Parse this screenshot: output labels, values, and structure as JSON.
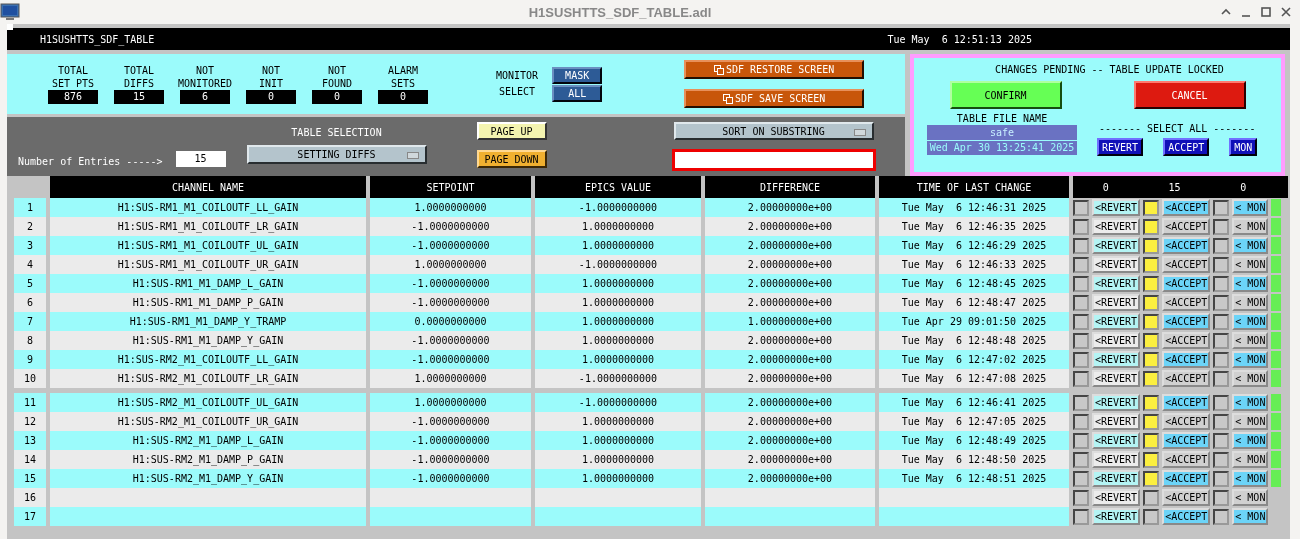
{
  "window": {
    "title": "H1SUSHTTS_SDF_TABLE.adl"
  },
  "header_bar": {
    "name": "H1SUSHTTS_SDF_TABLE",
    "datetime": "Tue May  6 12:51:13 2025"
  },
  "stats": [
    {
      "label": "TOTAL\nSET PTS",
      "value": "876"
    },
    {
      "label": "TOTAL\nDIFFS",
      "value": "15"
    },
    {
      "label": "NOT\nMONITORED",
      "value": "6"
    },
    {
      "label": "NOT\nINIT",
      "value": "0"
    },
    {
      "label": "NOT\nFOUND",
      "value": "0"
    },
    {
      "label": "ALARM\nSETS",
      "value": "0"
    }
  ],
  "monitor_select": {
    "label": "MONITOR\nSELECT",
    "buttons": [
      "MASK",
      "ALL"
    ]
  },
  "screen_buttons": [
    "SDF RESTORE SCREEN",
    "SDF SAVE SCREEN"
  ],
  "controls": {
    "entries_label": "Number of Entries ----->",
    "entries_value": "15",
    "table_selection_label": "TABLE SELECTION",
    "table_selection": "SETTING DIFFS",
    "page_up": "PAGE UP",
    "page_down": "PAGE DOWN",
    "sort_menu": "SORT ON SUBSTRING"
  },
  "pending": {
    "message": "CHANGES PENDING -- TABLE UPDATE LOCKED",
    "confirm": "CONFIRM",
    "cancel": "CANCEL",
    "table_file_label": "TABLE FILE NAME",
    "table_file": "safe",
    "table_file_date": "Wed Apr 30 13:25:41 2025",
    "select_all_label": "------- SELECT ALL -------",
    "select_all_buttons": [
      "REVERT",
      "ACCEPT",
      "MON"
    ]
  },
  "table": {
    "columns": [
      "CHANNEL NAME",
      "SETPOINT",
      "EPICS VALUE",
      "DIFFERENCE",
      "TIME OF LAST CHANGE"
    ],
    "counts": [
      "0",
      "15",
      "0"
    ],
    "rows": [
      {
        "n": "1",
        "channel": "H1:SUS-RM1_M1_COILOUTF_LL_GAIN",
        "setpoint": "1.0000000000",
        "epics": "-1.0000000000",
        "difference": "2.00000000e+00",
        "time": "Tue May  6 12:46:31 2025",
        "revert": false,
        "revert_button": "<REVERT",
        "accept": true,
        "accept_button": "<ACCEPT",
        "mon": false,
        "mon_button": "< MON",
        "status_ok": true
      },
      {
        "n": "2",
        "channel": "H1:SUS-RM1_M1_COILOUTF_LR_GAIN",
        "setpoint": "-1.0000000000",
        "epics": "1.0000000000",
        "difference": "2.00000000e+00",
        "time": "Tue May  6 12:46:35 2025",
        "revert": false,
        "revert_button": "<REVERT",
        "accept": true,
        "accept_button": "<ACCEPT",
        "mon": false,
        "mon_button": "< MON",
        "status_ok": true
      },
      {
        "n": "3",
        "channel": "H1:SUS-RM1_M1_COILOUTF_UL_GAIN",
        "setpoint": "-1.0000000000",
        "epics": "1.0000000000",
        "difference": "2.00000000e+00",
        "time": "Tue May  6 12:46:29 2025",
        "revert": false,
        "revert_button": "<REVERT",
        "accept": true,
        "accept_button": "<ACCEPT",
        "mon": false,
        "mon_button": "< MON",
        "status_ok": true
      },
      {
        "n": "4",
        "channel": "H1:SUS-RM1_M1_COILOUTF_UR_GAIN",
        "setpoint": "1.0000000000",
        "epics": "-1.0000000000",
        "difference": "2.00000000e+00",
        "time": "Tue May  6 12:46:33 2025",
        "revert": false,
        "revert_button": "<REVERT",
        "accept": true,
        "accept_button": "<ACCEPT",
        "mon": false,
        "mon_button": "< MON",
        "status_ok": true
      },
      {
        "n": "5",
        "channel": "H1:SUS-RM1_M1_DAMP_L_GAIN",
        "setpoint": "-1.0000000000",
        "epics": "1.0000000000",
        "difference": "2.00000000e+00",
        "time": "Tue May  6 12:48:45 2025",
        "revert": false,
        "revert_button": "<REVERT",
        "accept": true,
        "accept_button": "<ACCEPT",
        "mon": false,
        "mon_button": "< MON",
        "status_ok": true
      },
      {
        "n": "6",
        "channel": "H1:SUS-RM1_M1_DAMP_P_GAIN",
        "setpoint": "-1.0000000000",
        "epics": "1.0000000000",
        "difference": "2.00000000e+00",
        "time": "Tue May  6 12:48:47 2025",
        "revert": false,
        "revert_button": "<REVERT",
        "accept": true,
        "accept_button": "<ACCEPT",
        "mon": false,
        "mon_button": "< MON",
        "status_ok": true
      },
      {
        "n": "7",
        "channel": "H1:SUS-RM1_M1_DAMP_Y_TRAMP",
        "setpoint": "0.0000000000",
        "epics": "1.0000000000",
        "difference": "1.00000000e+00",
        "time": "Tue Apr 29 09:01:50 2025",
        "revert": false,
        "revert_button": "<REVERT",
        "accept": true,
        "accept_button": "<ACCEPT",
        "mon": false,
        "mon_button": "< MON",
        "status_ok": true
      },
      {
        "n": "8",
        "channel": "H1:SUS-RM1_M1_DAMP_Y_GAIN",
        "setpoint": "-1.0000000000",
        "epics": "1.0000000000",
        "difference": "2.00000000e+00",
        "time": "Tue May  6 12:48:48 2025",
        "revert": false,
        "revert_button": "<REVERT",
        "accept": true,
        "accept_button": "<ACCEPT",
        "mon": false,
        "mon_button": "< MON",
        "status_ok": true
      },
      {
        "n": "9",
        "channel": "H1:SUS-RM2_M1_COILOUTF_LL_GAIN",
        "setpoint": "-1.0000000000",
        "epics": "1.0000000000",
        "difference": "2.00000000e+00",
        "time": "Tue May  6 12:47:02 2025",
        "revert": false,
        "revert_button": "<REVERT",
        "accept": true,
        "accept_button": "<ACCEPT",
        "mon": false,
        "mon_button": "< MON",
        "status_ok": true
      },
      {
        "n": "10",
        "channel": "H1:SUS-RM2_M1_COILOUTF_LR_GAIN",
        "setpoint": "1.0000000000",
        "epics": "-1.0000000000",
        "difference": "2.00000000e+00",
        "time": "Tue May  6 12:47:08 2025",
        "revert": false,
        "revert_button": "<REVERT",
        "accept": true,
        "accept_button": "<ACCEPT",
        "mon": false,
        "mon_button": "< MON",
        "status_ok": true
      },
      {
        "n": "11",
        "channel": "H1:SUS-RM2_M1_COILOUTF_UL_GAIN",
        "setpoint": "1.0000000000",
        "epics": "-1.0000000000",
        "difference": "2.00000000e+00",
        "time": "Tue May  6 12:46:41 2025",
        "revert": false,
        "revert_button": "<REVERT",
        "accept": true,
        "accept_button": "<ACCEPT",
        "mon": false,
        "mon_button": "< MON",
        "status_ok": true
      },
      {
        "n": "12",
        "channel": "H1:SUS-RM2_M1_COILOUTF_UR_GAIN",
        "setpoint": "-1.0000000000",
        "epics": "1.0000000000",
        "difference": "2.00000000e+00",
        "time": "Tue May  6 12:47:05 2025",
        "revert": false,
        "revert_button": "<REVERT",
        "accept": true,
        "accept_button": "<ACCEPT",
        "mon": false,
        "mon_button": "< MON",
        "status_ok": true
      },
      {
        "n": "13",
        "channel": "H1:SUS-RM2_M1_DAMP_L_GAIN",
        "setpoint": "-1.0000000000",
        "epics": "1.0000000000",
        "difference": "2.00000000e+00",
        "time": "Tue May  6 12:48:49 2025",
        "revert": false,
        "revert_button": "<REVERT",
        "accept": true,
        "accept_button": "<ACCEPT",
        "mon": false,
        "mon_button": "< MON",
        "status_ok": true
      },
      {
        "n": "14",
        "channel": "H1:SUS-RM2_M1_DAMP_P_GAIN",
        "setpoint": "-1.0000000000",
        "epics": "1.0000000000",
        "difference": "2.00000000e+00",
        "time": "Tue May  6 12:48:50 2025",
        "revert": false,
        "revert_button": "<REVERT",
        "accept": true,
        "accept_button": "<ACCEPT",
        "mon": false,
        "mon_button": "< MON",
        "status_ok": true
      },
      {
        "n": "15",
        "channel": "H1:SUS-RM2_M1_DAMP_Y_GAIN",
        "setpoint": "-1.0000000000",
        "epics": "1.0000000000",
        "difference": "2.00000000e+00",
        "time": "Tue May  6 12:48:51 2025",
        "revert": false,
        "revert_button": "<REVERT",
        "accept": true,
        "accept_button": "<ACCEPT",
        "mon": false,
        "mon_button": "< MON",
        "status_ok": true
      },
      {
        "n": "16",
        "revert": false,
        "revert_button": "<REVERT",
        "accept": false,
        "accept_button": "<ACCEPT",
        "mon": false,
        "mon_button": "< MON",
        "status_ok": false
      },
      {
        "n": "17",
        "revert": false,
        "revert_button": "<REVERT",
        "accept": false,
        "accept_button": "<ACCEPT",
        "mon": false,
        "mon_button": "< MON",
        "status_ok": false
      }
    ]
  }
}
